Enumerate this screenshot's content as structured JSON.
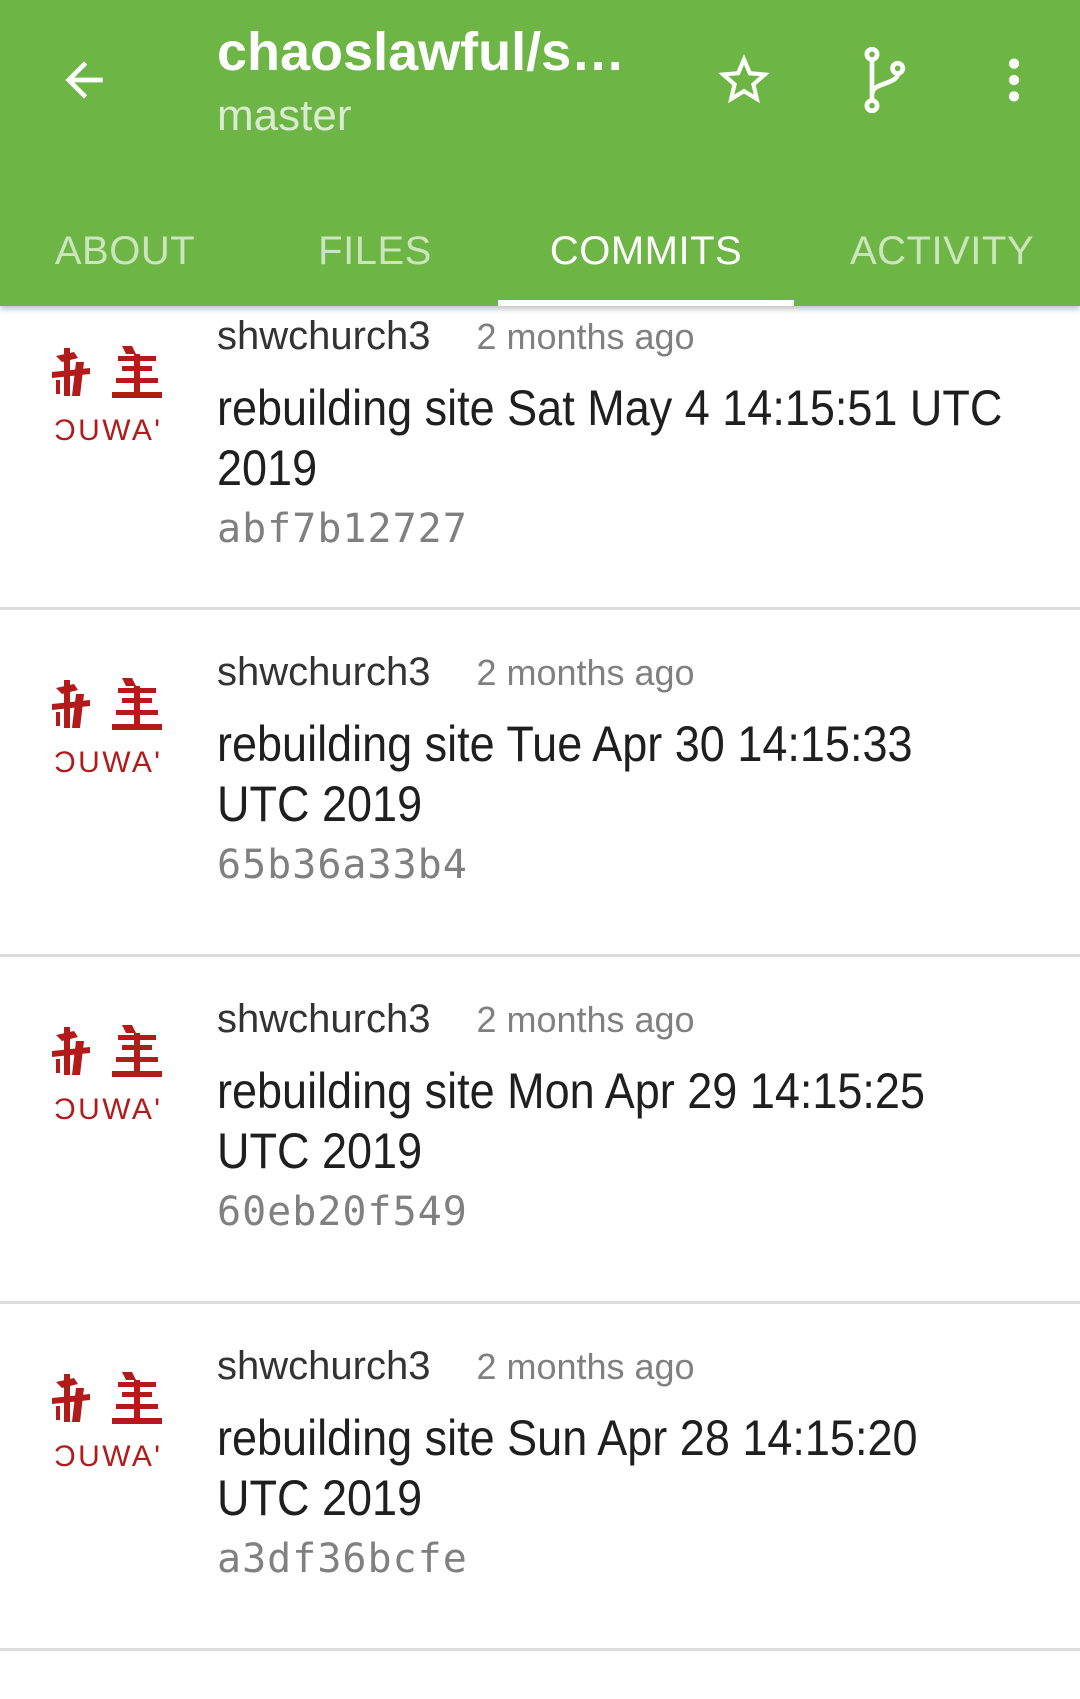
{
  "header": {
    "repo_title": "chaoslawful/s…",
    "branch": "master",
    "icons": {
      "back": "arrow-left-icon",
      "star": "star-outline-icon",
      "fork": "fork-icon",
      "more": "more-vertical-icon"
    },
    "colors": {
      "appbar": "#6db544",
      "avatar": "#b31b1b"
    }
  },
  "tabs": [
    {
      "label": "ABOUT",
      "active": false
    },
    {
      "label": "FILES",
      "active": false
    },
    {
      "label": "COMMITS",
      "active": true
    },
    {
      "label": "ACTIVITY",
      "active": false
    }
  ],
  "commits": [
    {
      "author": "shwchurch3",
      "time": "2 months ago",
      "message": "rebuilding site Sat May  4 14:15:51 UTC 2019",
      "sha": "abf7b12727",
      "avatar_text": "ƆUWA'"
    },
    {
      "author": "shwchurch3",
      "time": "2 months ago",
      "message": "rebuilding site Tue Apr 30 14:15:33 UTC 2019",
      "sha": "65b36a33b4",
      "avatar_text": "ƆUWA'"
    },
    {
      "author": "shwchurch3",
      "time": "2 months ago",
      "message": "rebuilding site Mon Apr 29 14:15:25 UTC 2019",
      "sha": "60eb20f549",
      "avatar_text": "ƆUWA'"
    },
    {
      "author": "shwchurch3",
      "time": "2 months ago",
      "message": "rebuilding site Sun Apr 28 14:15:20 UTC 2019",
      "sha": "a3df36bcfe",
      "avatar_text": "ƆUWA'"
    }
  ]
}
